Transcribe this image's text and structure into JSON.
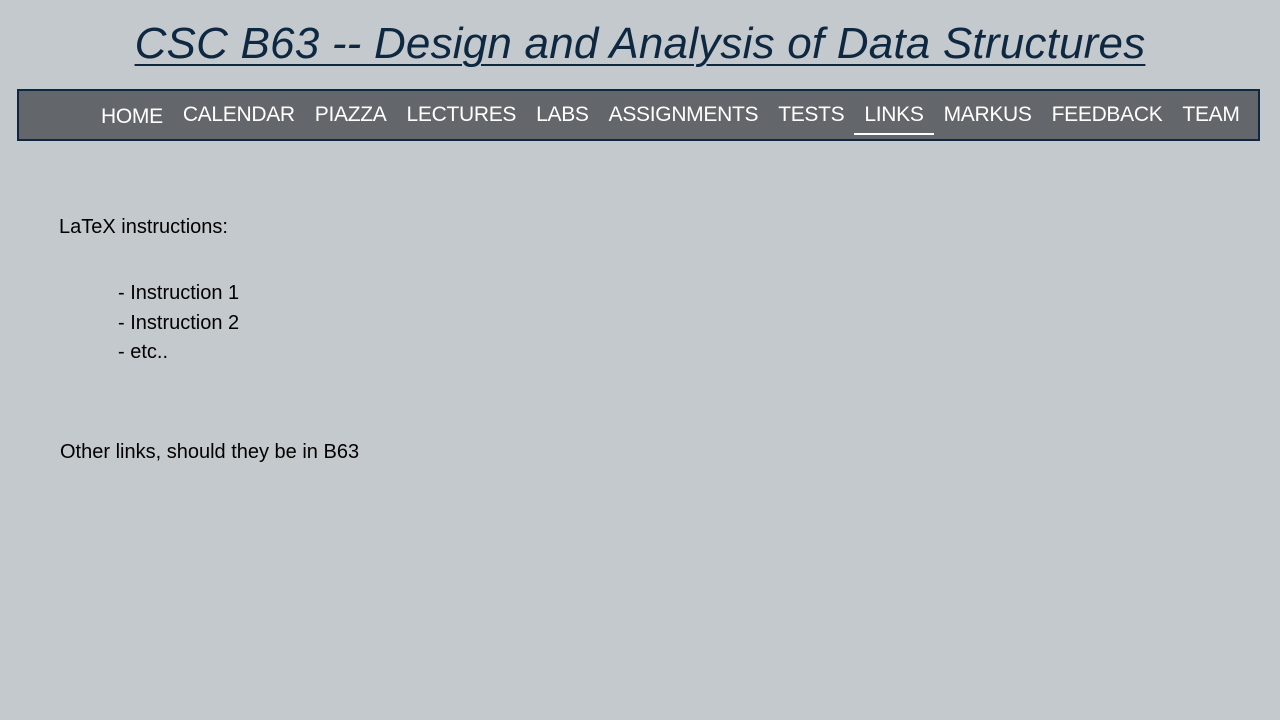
{
  "header": {
    "title": "CSC B63 -- Design and Analysis of Data Structures"
  },
  "nav": {
    "active": "LINKS",
    "items": [
      {
        "label": "HOME"
      },
      {
        "label": "CALENDAR"
      },
      {
        "label": "PIAZZA"
      },
      {
        "label": "LECTURES"
      },
      {
        "label": "LABS"
      },
      {
        "label": "ASSIGNMENTS"
      },
      {
        "label": "TESTS"
      },
      {
        "label": "LINKS"
      },
      {
        "label": "MARKUS"
      },
      {
        "label": "FEEDBACK"
      },
      {
        "label": "TEAM"
      }
    ]
  },
  "main": {
    "latex_heading": "LaTeX instructions:",
    "instructions": [
      "- Instruction 1",
      "- Instruction 2",
      "- etc.."
    ],
    "other_links": "Other links, should they be in B63"
  },
  "colors": {
    "background": "#c4c9cd",
    "nav_background": "#63666a",
    "title_color": "#0e2841",
    "nav_text": "#ffffff"
  }
}
